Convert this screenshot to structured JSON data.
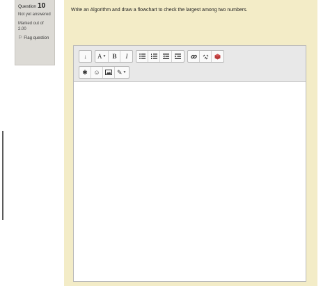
{
  "question_info": {
    "label": "Question",
    "number": "10",
    "state": "Not yet answered",
    "marks": "Marked out of 2.00",
    "flag": "Flag question"
  },
  "question_text": "Write an Algorithm and draw a flowchart to check the largest among two numbers.",
  "toolbar": {
    "row1": [
      {
        "name": "toolbar-toggle-button",
        "icon": "toolbar-toggle-icon",
        "glyph": "↓"
      },
      {
        "name": "font-style-button",
        "icon": "font-style-icon",
        "glyph": "A",
        "dropdown": true
      },
      {
        "name": "bold-button",
        "icon": "bold-icon",
        "glyph": "B"
      },
      {
        "name": "italic-button",
        "icon": "italic-icon",
        "glyph": "I"
      },
      {
        "name": "unordered-list-button",
        "icon": "unordered-list-icon",
        "glyph": "☰"
      },
      {
        "name": "ordered-list-button",
        "icon": "ordered-list-icon",
        "glyph": "☷"
      },
      {
        "name": "outdent-button",
        "icon": "outdent-icon",
        "glyph": "⇤"
      },
      {
        "name": "indent-button",
        "icon": "indent-icon",
        "glyph": "⇥"
      },
      {
        "name": "link-button",
        "icon": "link-icon",
        "glyph": "🔗"
      },
      {
        "name": "unlink-button",
        "icon": "unlink-icon",
        "glyph": "⚯"
      },
      {
        "name": "media-button",
        "icon": "media-icon",
        "glyph": "◆"
      }
    ],
    "row2": [
      {
        "name": "equation-button",
        "icon": "equation-icon",
        "glyph": "✱"
      },
      {
        "name": "emoticon-button",
        "icon": "emoticon-icon",
        "glyph": "☺"
      },
      {
        "name": "image-button",
        "icon": "image-icon",
        "glyph": "▣"
      },
      {
        "name": "draw-button",
        "icon": "draw-icon",
        "glyph": "✎",
        "dropdown": true
      }
    ]
  },
  "colors": {
    "content_bg": "#f3ecc7",
    "info_bg": "#dcdad5",
    "toolbar_bg": "#e8e8e8",
    "media_icon": "#b83a3a"
  }
}
